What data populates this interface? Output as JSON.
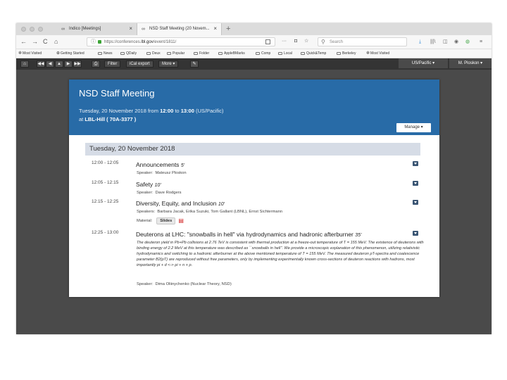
{
  "browser": {
    "tabs": [
      {
        "icon": "indico-icon",
        "title": "Indico [Meetings]"
      },
      {
        "icon": "indico-icon",
        "title": "NSD Staff Meeting (20 Novem..."
      }
    ],
    "close_glyph": "×",
    "newtab_glyph": "+",
    "nav": {
      "back": "←",
      "forward": "→",
      "reload": "C",
      "home": "⌂"
    },
    "url_prefix": "https://conferences.",
    "url_domain": "lbl.gov",
    "url_path": "/event/1811/",
    "page_actions": {
      "more": "···",
      "pocket": "◘",
      "star": "☆"
    },
    "search_placeholder": "Search",
    "toolbar_icons": {
      "download": "⤓",
      "library": "|||\\",
      "sidebar": "◫",
      "account": "◉",
      "extension": "◍",
      "menu": "≡"
    }
  },
  "bookmarks": [
    {
      "label": "Most Visited",
      "icon": "gear-icon"
    },
    {
      "label": "Getting Started",
      "icon": "globe-icon"
    },
    {
      "label": "News",
      "icon": "folder-icon"
    },
    {
      "label": "QDaily",
      "icon": "folder-icon"
    },
    {
      "label": "Deux",
      "icon": "folder-icon"
    },
    {
      "label": "Popular",
      "icon": "folder-icon"
    },
    {
      "label": "Folder",
      "icon": "folder-icon"
    },
    {
      "label": "AppleBMarks",
      "icon": "folder-icon"
    },
    {
      "label": "Comp",
      "icon": "folder-icon"
    },
    {
      "label": "Local",
      "icon": "folder-icon"
    },
    {
      "label": "Quick&Temp",
      "icon": "folder-icon"
    },
    {
      "label": "Berkeley",
      "icon": "folder-icon"
    },
    {
      "label": "Most Visited",
      "icon": "gear-icon"
    }
  ],
  "indico_toolbar": {
    "home": "⌂",
    "nav": [
      "◀◀",
      "◀",
      "▲",
      "▶",
      "▶▶"
    ],
    "print": "⎙",
    "filter": "Filter",
    "ical": "iCal export",
    "more": "More ▾",
    "edit": "✎",
    "timezone": "US/Pacific ▾",
    "user": "M. Ploskon ▾"
  },
  "event": {
    "title": "NSD Staff Meeting",
    "when_prefix": "Tuesday, 20 November 2018 from ",
    "start": "12:00",
    "to": " to ",
    "end": "13:00",
    "tz": " (US/Pacific)",
    "at": "at ",
    "location": "LBL-Hill ( 70A-3377 )",
    "manage": "Manage ▾"
  },
  "day": "Tuesday, 20 November 2018",
  "contributions": [
    {
      "time": "12:00 - 12:05",
      "title": "Announcements",
      "duration": "5'",
      "speaker_label": "Speaker:",
      "speakers": "Mateusz Ploskon"
    },
    {
      "time": "12:05 - 12:15",
      "title": "Safety",
      "duration": "10'",
      "speaker_label": "Speaker:",
      "speakers": "Dave Rodgers"
    },
    {
      "time": "12:15 - 12:25",
      "title": "Diversity, Equity, and Inclusion",
      "duration": "10'",
      "speaker_label": "Speakers:",
      "speakers": "Barbara Jacak, Erika Suzuki, Tom Gallant (LBNL), Ernst Sichtermann",
      "material_label": "Material:",
      "material": "Slides"
    },
    {
      "time": "12:25 - 13:00",
      "title": "Deuterons at LHC: \"snowballs in hell\" via hydrodynamics and hadronic afterburner",
      "duration": "35'",
      "description": "The deuteron yield in Pb+Pb collisions at 2.76 TeV is consistent with thermal production at a freeze-out temperature of T = 155 MeV. The existence of deuterons with binding energy of 2.2 MeV at this temperature was described as ``snowballs in hell''. We provide a microscopic explanation of this phenomenon, utilizing relativistic hydrodynamics and switching to a hadronic afterburner at the above mentioned temperature of T = 155 MeV. The measured deuteron pT-spectra and coalescence parameter B2(pT) are reproduced without free parameters, only by implementing experimentally known cross-sections of deuteron reactions with hadrons, most importantly pi + d <-> pi + n + p.",
      "speaker_label": "Speaker:",
      "speakers": "Dima Oliinychenko (Nuclear Theory, NSD)"
    }
  ]
}
